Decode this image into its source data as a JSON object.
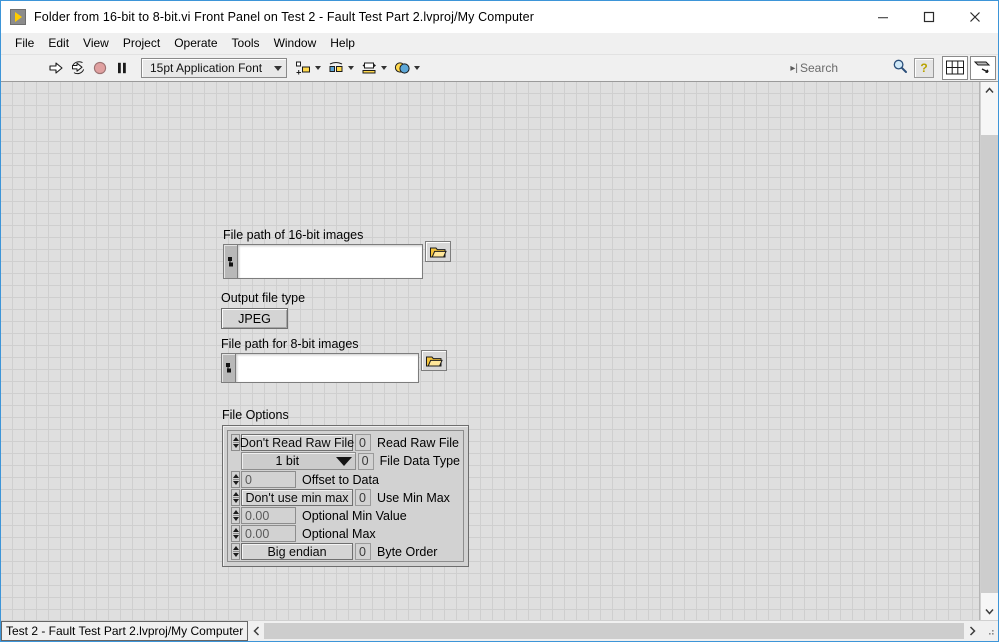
{
  "window": {
    "title": "Folder from 16-bit to 8-bit.vi Front Panel on Test 2 - Fault Test Part 2.lvproj/My Computer",
    "app_icon": "labview-vi-icon",
    "minimize_label": "minimize-icon",
    "maximize_label": "maximize-icon",
    "close_label": "close-icon"
  },
  "menu": {
    "items": [
      {
        "label": "File"
      },
      {
        "label": "Edit"
      },
      {
        "label": "View"
      },
      {
        "label": "Project"
      },
      {
        "label": "Operate"
      },
      {
        "label": "Tools"
      },
      {
        "label": "Window"
      },
      {
        "label": "Help"
      }
    ]
  },
  "toolbar": {
    "run_icon": "run-arrow-icon",
    "run_continuously_icon": "run-continuously-icon",
    "abort_icon": "abort-execution-icon",
    "pause_icon": "pause-icon",
    "font_selector": "15pt Application Font",
    "align_icon": "align-objects-icon",
    "distribute_icon": "distribute-objects-icon",
    "resize_icon": "resize-objects-icon",
    "reorder_icon": "reorder-objects-icon",
    "search_placeholder": "Search",
    "search_value": "",
    "search_icon": "magnifier-icon",
    "help_icon": "context-help-icon",
    "tile_windows_icon": "tile-windows-icon",
    "show_diagram_icon": "show-block-diagram-icon"
  },
  "panel": {
    "path16": {
      "label": "File path of 16-bit images",
      "value": "",
      "browse_icon": "folder-browse-icon",
      "path_icon": "path-terminal-icon"
    },
    "output_file_type": {
      "label": "Output file type",
      "value": "JPEG"
    },
    "path8": {
      "label": "File path for 8-bit images",
      "value": "",
      "browse_icon": "folder-browse-icon",
      "path_icon": "path-terminal-icon"
    },
    "file_options": {
      "label": "File Options",
      "rows": [
        {
          "kind": "enum",
          "value": "Don't Read Raw File",
          "numeric": "0",
          "label": "Read Raw File"
        },
        {
          "kind": "dropdown",
          "value": "1 bit",
          "numeric": "0",
          "label": "File Data Type"
        },
        {
          "kind": "numeric",
          "value": "0",
          "numeric": "",
          "label": "Offset to Data"
        },
        {
          "kind": "enum",
          "value": "Don't use min max",
          "numeric": "0",
          "label": "Use Min Max"
        },
        {
          "kind": "numeric",
          "value": "0.00",
          "numeric": "",
          "label": "Optional Min Value"
        },
        {
          "kind": "numeric",
          "value": "0.00",
          "numeric": "",
          "label": "Optional Max"
        },
        {
          "kind": "enum",
          "value": "Big endian",
          "numeric": "0",
          "label": "Byte Order"
        }
      ]
    }
  },
  "statusbar": {
    "context": "Test 2 - Fault Test Part 2.lvproj/My Computer",
    "left_arrow": "scroll-left-icon",
    "right_arrow": "scroll-right-icon",
    "resize_grip": "resize-grip-icon"
  },
  "scrollbars": {
    "vertical_up": "scroll-up-icon",
    "vertical_down": "scroll-down-icon"
  },
  "colors": {
    "accent": "#3d95d8",
    "panel_bg": "#dfdfdf",
    "grid_line": "#cfcfcf",
    "control_face": "#d2d2d2",
    "icon_yellow": "#ffcc00"
  }
}
